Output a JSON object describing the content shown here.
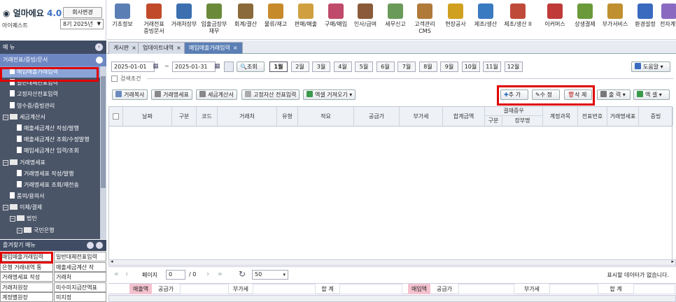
{
  "app": {
    "logo_text": "얼마에요",
    "logo_version": "4.0",
    "company_button": "회사변경",
    "user": "아이퀘스트",
    "year": "8기 2025년"
  },
  "toolbar": [
    {
      "label": "기초정보",
      "icon": "basic-info-icon",
      "color": "#5b7fb5"
    },
    {
      "label": "거래전표\n증빙문서",
      "icon": "voucher-icon",
      "color": "#c04a2a"
    },
    {
      "label": "거래처장부",
      "icon": "ledger-icon",
      "color": "#3b6fb0"
    },
    {
      "label": "입출금장부\n채무",
      "icon": "cash-book-icon",
      "color": "#6a8a3a"
    },
    {
      "label": "회계/결산",
      "icon": "accounting-icon",
      "color": "#8a6a3a"
    },
    {
      "label": "물류/재고",
      "icon": "logistics-icon",
      "color": "#c68a2a"
    },
    {
      "label": "판매/매출",
      "icon": "sales-icon",
      "color": "#d0a040"
    },
    {
      "label": "구매/매입",
      "icon": "purchase-icon",
      "color": "#c04a6a"
    },
    {
      "label": "인사/급여",
      "icon": "hr-icon",
      "color": "#8a5a3a"
    },
    {
      "label": "세무신고",
      "icon": "tax-icon",
      "color": "#6a9a5a"
    },
    {
      "label": "고객관리\nCMS",
      "icon": "customer-icon",
      "color": "#b07a3a"
    },
    {
      "label": "현장공사",
      "icon": "construction-icon",
      "color": "#d0a020"
    },
    {
      "label": "제조/생산",
      "icon": "factory-icon",
      "color": "#3a7ac0"
    },
    {
      "label": "제조/생산 II",
      "icon": "factory2-icon",
      "color": "#c04a3a"
    },
    {
      "label": "이커머스",
      "icon": "ecommerce-icon",
      "color": "#c03a3a"
    },
    {
      "label": "상생결제",
      "icon": "payment-icon",
      "color": "#6a9a3a"
    },
    {
      "label": "부가서비스",
      "icon": "service-icon",
      "color": "#c09030"
    },
    {
      "label": "환경설정",
      "icon": "settings-icon",
      "color": "#3a6ac0"
    },
    {
      "label": "전자계약",
      "icon": "contract-icon",
      "color": "#8a6ac0"
    }
  ],
  "menu_title": "메 뉴",
  "tabs": [
    {
      "label": "게시판"
    },
    {
      "label": "업데이트내역"
    },
    {
      "label": "매입매출거래입력"
    }
  ],
  "sidebar": {
    "section": "거래전표/증빙/문서",
    "items": [
      {
        "label": "매입매출거래입력",
        "kind": "doc",
        "indent": 1
      },
      {
        "label": "일반대체전표입력",
        "kind": "doc",
        "indent": 1
      },
      {
        "label": "고정자산전표입력",
        "kind": "doc",
        "indent": 1
      },
      {
        "label": "영수증/증빙관리",
        "kind": "doc",
        "indent": 1
      },
      {
        "label": "세금계산서",
        "kind": "folder",
        "indent": 0
      },
      {
        "label": "매출세금계산 작성/발행",
        "kind": "doc",
        "indent": 2
      },
      {
        "label": "매출세금계산 조회/수정발행",
        "kind": "doc",
        "indent": 2
      },
      {
        "label": "매입세금계산 입력/조회",
        "kind": "doc",
        "indent": 2
      },
      {
        "label": "거래명세표",
        "kind": "folder",
        "indent": 0
      },
      {
        "label": "거래명세표 작성/발행",
        "kind": "doc",
        "indent": 2
      },
      {
        "label": "거래명세표 조회/재전송",
        "kind": "doc",
        "indent": 2
      },
      {
        "label": "품의/용의서",
        "kind": "doc",
        "indent": 1
      },
      {
        "label": "이체/결제",
        "kind": "folder",
        "indent": 0
      },
      {
        "label": "법인",
        "kind": "folder",
        "indent": 1
      },
      {
        "label": "국민은행",
        "kind": "folder",
        "indent": 2
      }
    ]
  },
  "quick": {
    "title": "즐겨찾기 메뉴",
    "items": [
      "매입매출거래입력",
      "일반대체전표입력",
      "은행 거래내역 통",
      "매출세금계산 작",
      "거래명세표 작성",
      "거래처",
      "거래처원장",
      "미수미지급잔액표",
      "계정별원장",
      "미지정"
    ]
  },
  "main": {
    "date_from": "2025-01-01",
    "date_to": "2025-01-31",
    "date_sep": "~",
    "search_label": "조회",
    "periods": [
      "1월",
      "2월",
      "3월",
      "4월",
      "5월",
      "6월",
      "7월",
      "8월",
      "9월",
      "10월",
      "11월",
      "12월"
    ],
    "help_label": "도움말",
    "search_cond": "검색조건",
    "actions": {
      "copy": "거래복사",
      "stmt": "거래명세표",
      "tax": "세금계산서",
      "asset": "고정자산 전표입력",
      "excel": "엑셀 거져오기",
      "add": "추 가",
      "edit": "수 정",
      "delete": "삭 제",
      "print": "출 력",
      "excel_out": "엑 셀"
    },
    "columns": {
      "date": "날짜",
      "type": "구분",
      "code": "코드",
      "partner": "거래처",
      "kind": "유형",
      "summary": "적요",
      "supply": "공급가",
      "vat": "부가세",
      "total": "합계금액",
      "evidence": "결재증우",
      "ev_type": "구분",
      "ev_book": "장부명",
      "account": "계정과목",
      "slip": "전표번호",
      "stmt": "거래명세표",
      "proof": "증빙"
    },
    "pager": {
      "page_label": "페이지",
      "page": "0",
      "of": "/ 0",
      "size": "50",
      "empty": "표시할 데이터가 없습니다."
    },
    "summary": {
      "sales": "매출액",
      "supply": "공급가",
      "vat": "부가세",
      "total": "합 계",
      "purchase": "매입액",
      "supply2": "공급가",
      "vat2": "부가세",
      "total2": "합 계"
    }
  }
}
